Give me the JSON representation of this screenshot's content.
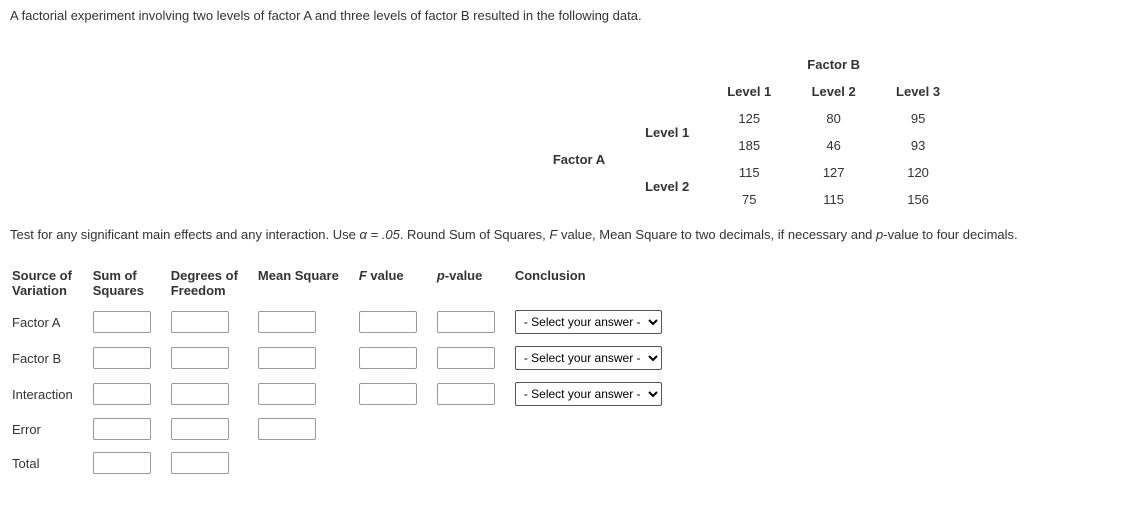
{
  "intro": "A factorial experiment involving two levels of factor A and three levels of factor B resulted in the following data.",
  "factor_b_label": "Factor B",
  "factor_a_label": "Factor A",
  "col_headers": [
    "Level 1",
    "Level 2",
    "Level 3"
  ],
  "row_headers": [
    "Level 1",
    "Level 2"
  ],
  "data_rows": {
    "r1a": [
      "125",
      "80",
      "95"
    ],
    "r1b": [
      "185",
      "46",
      "93"
    ],
    "r2a": [
      "115",
      "127",
      "120"
    ],
    "r2b": [
      "75",
      "115",
      "156"
    ]
  },
  "instructions_pre": "Test for any significant main effects and any interaction. Use ",
  "alpha_eq": "α = .05",
  "instructions_post": ". Round Sum of Squares, ",
  "fval_it": "F",
  "instructions_post2": " value, Mean Square to two decimals, if necessary and ",
  "pval_it": "p",
  "instructions_post3": "-value to four decimals.",
  "headers": {
    "source_l1": "Source of",
    "source_l2": "Variation",
    "ss_l1": "Sum of",
    "ss_l2": "Squares",
    "df_l1": "Degrees of",
    "df_l2": "Freedom",
    "ms": "Mean Square",
    "f_pre": "F",
    "f_post": " value",
    "p_pre": "p",
    "p_post": "-value",
    "concl": "Conclusion"
  },
  "rows": {
    "factor_a": "Factor A",
    "factor_b": "Factor B",
    "interaction": "Interaction",
    "error": "Error",
    "total": "Total"
  },
  "select_placeholder": "- Select your answer -"
}
